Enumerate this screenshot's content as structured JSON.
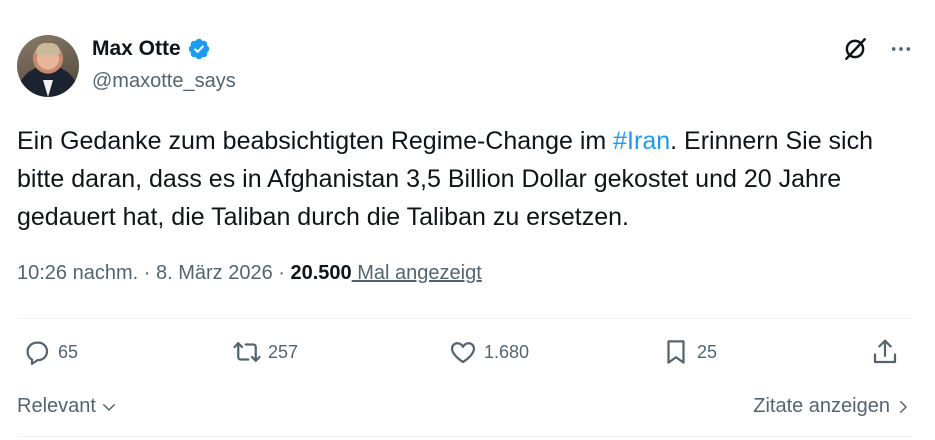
{
  "author": {
    "name": "Max Otte",
    "handle": "@maxotte_says",
    "verified": true
  },
  "tweet": {
    "text_before": "Ein Gedanke zum beabsichtigten Regime-Change im ",
    "hashtag": "#Iran",
    "text_after": ". Erinnern Sie sich bitte daran, dass es in Afghanistan 3,5 Billion Dollar gekostet und 20 Jahre gedauert hat, die Taliban durch die Taliban zu ersetzen."
  },
  "meta": {
    "time": "10:26 nachm.",
    "separator1": " · ",
    "date": "8. März 2026",
    "separator2": " · ",
    "views_count": "20.500",
    "views_label": " Mal angezeigt"
  },
  "actions": {
    "replies": "65",
    "reposts": "257",
    "likes": "1.680",
    "bookmarks": "25"
  },
  "footer": {
    "sort_label": "Relevant",
    "quotes_label": "Zitate anzeigen"
  },
  "icons": {
    "verified": "verified-badge-icon",
    "grok": "grok-icon",
    "more": "more-icon",
    "reply": "reply-icon",
    "repost": "repost-icon",
    "like": "heart-icon",
    "bookmark": "bookmark-icon",
    "share": "share-icon",
    "chevron_down": "chevron-down-icon",
    "chevron_right": "chevron-right-icon"
  },
  "colors": {
    "accent": "#1d9bf0",
    "text": "#0f1419",
    "secondary": "#536471"
  }
}
